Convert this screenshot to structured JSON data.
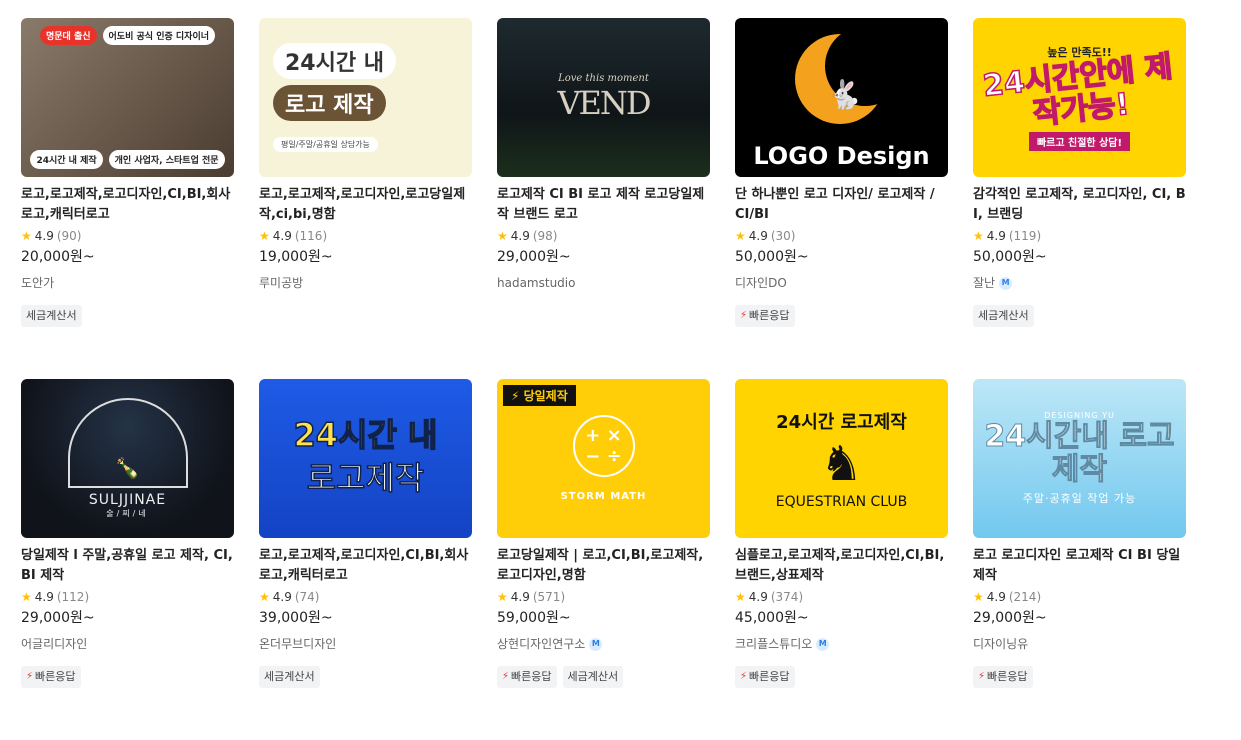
{
  "cards": [
    {
      "thumb": {
        "pill_a": "명문대 출신",
        "pill_b": "어도비 공식 인증 디자이너",
        "pill_c": "24시간 내 제작",
        "pill_d": "개인 사업자, 스타트업 전문"
      },
      "title": "로고,로고제작,로고디자인,CI,BI,회사로고,캐릭터로고",
      "rating": "4.9",
      "reviews": "(90)",
      "price": "20,000원~",
      "seller": "도안가",
      "tags": [
        "세금계산서"
      ],
      "fast": false
    },
    {
      "thumb": {
        "line1": "24시간 내",
        "line2": "로고 제작",
        "line3": "평일/주말/공휴일 상담가능"
      },
      "title": "로고,로고제작,로고디자인,로고당일제작,ci,bi,명함",
      "rating": "4.9",
      "reviews": "(116)",
      "price": "19,000원~",
      "seller": "루미공방",
      "tags": [],
      "fast": false
    },
    {
      "thumb": {
        "script": "Love this moment",
        "mono": "VEND"
      },
      "title": "로고제작 CI BI 로고 제작 로고당일제작 브랜드 로고",
      "rating": "4.9",
      "reviews": "(98)",
      "price": "29,000원~",
      "seller": "hadamstudio",
      "tags": [],
      "fast": false
    },
    {
      "thumb": {
        "text": "LOGO Design"
      },
      "title": "단 하나뿐인 로고 디자인/ 로고제작 / CI/BI",
      "rating": "4.9",
      "reviews": "(30)",
      "price": "50,000원~",
      "seller": "디자인DO",
      "tags": [],
      "fast": true,
      "fast_label": "빠른응답"
    },
    {
      "thumb": {
        "top": "높은 만족도!!",
        "big": "24시간안에 제작가능!",
        "bottom": "빠르고 친절한 상담!"
      },
      "title": "감각적인 로고제작, 로고디자인, CI, BI, 브랜딩",
      "rating": "4.9",
      "reviews": "(119)",
      "price": "50,000원~",
      "seller": "잘난",
      "badge": "M",
      "tags": [
        "세금계산서"
      ],
      "fast": false
    },
    {
      "thumb": {
        "name": "SULJJINAE",
        "sub": "술/찌/네"
      },
      "title": "당일제작 l 주말,공휴일 로고 제작, CI, BI 제작",
      "rating": "4.9",
      "reviews": "(112)",
      "price": "29,000원~",
      "seller": "어글리디자인",
      "tags": [],
      "fast": true,
      "fast_label": "빠른응답"
    },
    {
      "thumb": {
        "line1": "24시간 내",
        "line2": "로고제작"
      },
      "title": "로고,로고제작,로고디자인,CI,BI,회사로고,캐릭터로고",
      "rating": "4.9",
      "reviews": "(74)",
      "price": "39,000원~",
      "seller": "온더무브디자인",
      "tags": [
        "세금계산서"
      ],
      "fast": false
    },
    {
      "thumb": {
        "flag": "⚡ 당일제작",
        "name": "STORM MATH"
      },
      "title": "로고당일제작 | 로고,CI,BI,로고제작,로고디자인,명함",
      "rating": "4.9",
      "reviews": "(571)",
      "price": "59,000원~",
      "seller": "상현디자인연구소",
      "badge": "M",
      "tags": [
        "세금계산서"
      ],
      "fast": true,
      "fast_label": "빠른응답"
    },
    {
      "thumb": {
        "head": "24시간 로고제작",
        "name": "EQUESTRIAN CLUB"
      },
      "title": "심플로고,로고제작,로고디자인,CI,BI,브랜드,상표제작",
      "rating": "4.9",
      "reviews": "(374)",
      "price": "45,000원~",
      "seller": "크리플스튜디오",
      "badge": "M",
      "tags": [],
      "fast": true,
      "fast_label": "빠른응답"
    },
    {
      "thumb": {
        "logo": "DESIGNING YU",
        "big": "24시간내 로고제작",
        "sub": "주말·공휴일 작업 가능"
      },
      "title": "로고 로고디자인 로고제작 CI BI 당일제작",
      "rating": "4.9",
      "reviews": "(214)",
      "price": "29,000원~",
      "seller": "디자이닝유",
      "tags": [],
      "fast": true,
      "fast_label": "빠른응답"
    }
  ],
  "icons": {
    "rating": "star-icon",
    "fast": "lightning-icon",
    "verified": "m-badge-icon"
  },
  "colors": {
    "star": "#ffc107",
    "bolt": "#e8332b"
  }
}
